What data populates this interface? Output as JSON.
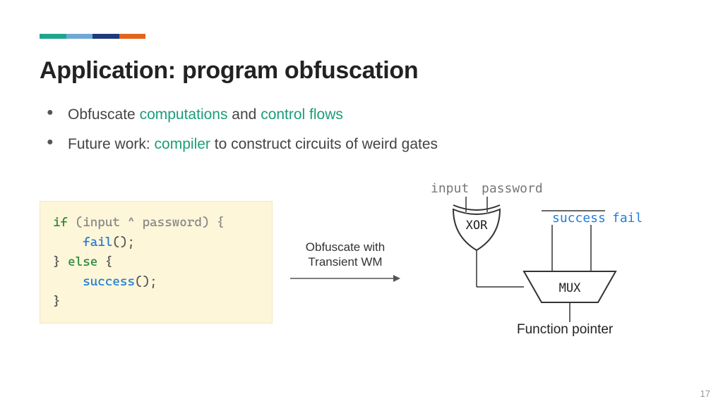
{
  "accent_colors": [
    "#1fa58c",
    "#6fa8d6",
    "#1e3a7b",
    "#e4641c"
  ],
  "title": "Application: program obfuscation",
  "bullets": [
    {
      "pre": "Obfuscate ",
      "hl1": "computations",
      "mid": " and ",
      "hl2": "control flows",
      "post": ""
    },
    {
      "pre": "Future work: ",
      "hl1": "compiler",
      "mid": " to construct circuits of weird gates",
      "hl2": "",
      "post": ""
    }
  ],
  "code": {
    "l1_kw": "if",
    "l1_rest1": " (input ",
    "l1_op": "^",
    "l1_rest2": " password) {",
    "l2_indent": "    ",
    "l2_fn": "fail",
    "l2_rest": "();",
    "l3_brace": "} ",
    "l3_kw": "else",
    "l3_rest": " {",
    "l4_indent": "    ",
    "l4_fn": "success",
    "l4_rest": "();",
    "l5": "}"
  },
  "arrow_caption_l1": "Obfuscate with",
  "arrow_caption_l2": "Transient WM",
  "diagram": {
    "input": "input",
    "password": "password",
    "success": "success",
    "fail": "fail",
    "xor": "XOR",
    "mux": "MUX",
    "fnptr": "Function pointer"
  },
  "page_number": "17"
}
